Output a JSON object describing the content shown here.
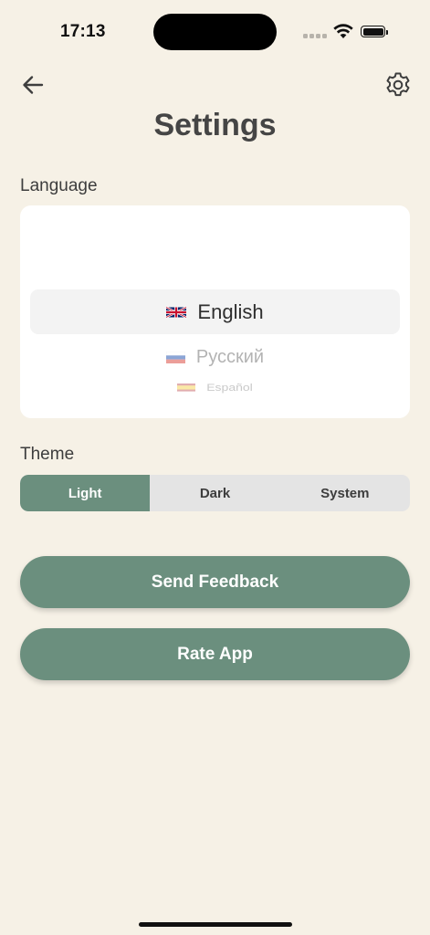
{
  "status_bar": {
    "time": "17:13",
    "icons": [
      "cellular-signal-icon",
      "wifi-icon",
      "battery-icon"
    ]
  },
  "header": {
    "back_icon": "arrow-left-icon",
    "settings_icon": "gear-icon",
    "title": "Settings"
  },
  "language": {
    "label": "Language",
    "options": [
      {
        "flag": "uk-flag-icon",
        "name": "English",
        "selected": true
      },
      {
        "flag": "russia-flag-icon",
        "name": "Русский",
        "selected": false
      },
      {
        "flag": "spain-flag-icon",
        "name": "Español",
        "selected": false
      }
    ]
  },
  "theme": {
    "label": "Theme",
    "options": [
      "Light",
      "Dark",
      "System"
    ],
    "selected": "Light"
  },
  "actions": {
    "send_feedback": "Send Feedback",
    "rate_app": "Rate App"
  },
  "colors": {
    "background": "#f6f1e6",
    "accent": "#6b8f7e",
    "card": "#ffffff",
    "segment_bg": "#e4e4e4"
  }
}
